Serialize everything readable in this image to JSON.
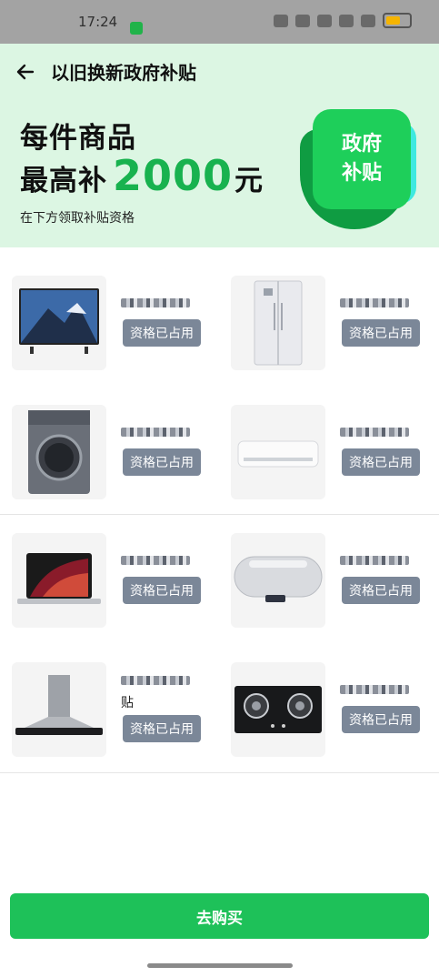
{
  "status_bar": {
    "time": "17:24"
  },
  "header": {
    "title": "以旧换新政府补贴",
    "promo_line1": "每件商品",
    "promo_prefix": "最高补",
    "promo_amount": "2000",
    "promo_unit": "元",
    "promo_sub": "在下方领取补贴资格",
    "badge_line1": "政府",
    "badge_line2": "补贴"
  },
  "products": [
    {
      "name_suffix": "",
      "button": "资格已占用",
      "icon": "tv-icon"
    },
    {
      "name_suffix": "",
      "button": "资格已占用",
      "icon": "refrigerator-icon"
    },
    {
      "name_suffix": "",
      "button": "资格已占用",
      "icon": "washing-machine-icon"
    },
    {
      "name_suffix": "",
      "button": "资格已占用",
      "icon": "air-conditioner-icon"
    },
    {
      "name_suffix": "",
      "button": "资格已占用",
      "icon": "laptop-icon"
    },
    {
      "name_suffix": "",
      "button": "资格已占用",
      "icon": "water-heater-icon"
    },
    {
      "name_suffix": "贴",
      "button": "资格已占用",
      "icon": "range-hood-icon"
    },
    {
      "name_suffix": "",
      "button": "资格已占用",
      "icon": "gas-stove-icon"
    }
  ],
  "buy_button": "去购买",
  "colors": {
    "accent": "#1ec159",
    "header_bg": "#dcf6e3",
    "disabled_button": "#7b8798"
  }
}
